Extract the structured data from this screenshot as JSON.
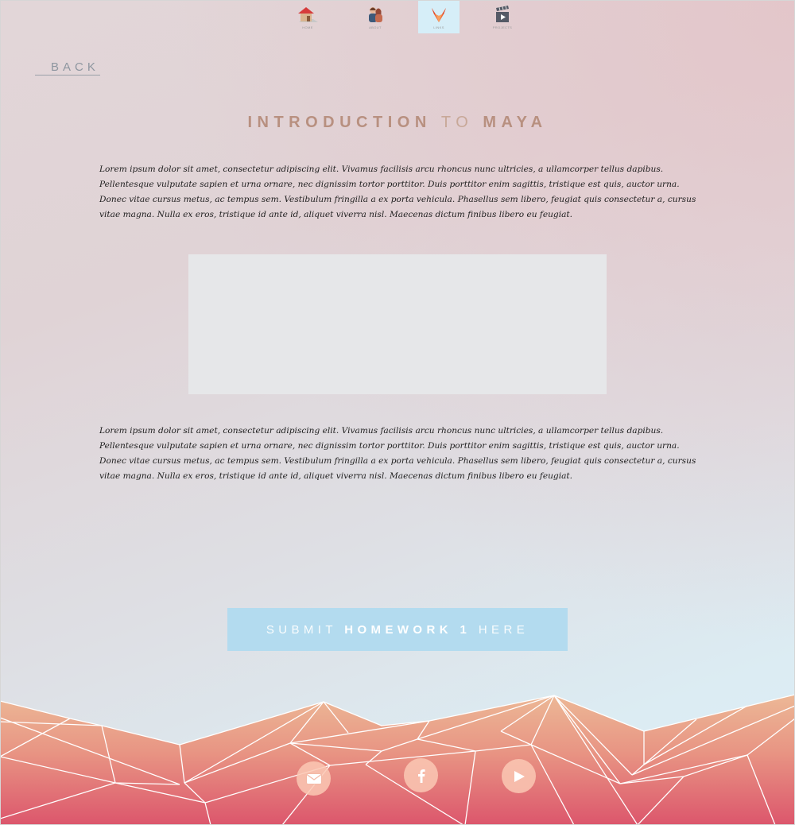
{
  "nav": {
    "items": [
      {
        "label": "HOME",
        "icon": "house-icon"
      },
      {
        "label": "ABOUT",
        "icon": "couple-icon"
      },
      {
        "label": "LINKS",
        "icon": "fox-icon"
      },
      {
        "label": "PROJECTS",
        "icon": "clapperboard-icon"
      }
    ],
    "active_index": 2
  },
  "back": {
    "label": "BACK"
  },
  "title": {
    "part1": "INTRODUCTION",
    "part2": "TO",
    "part3": "MAYA"
  },
  "paragraphs": [
    "Lorem ipsum dolor sit amet, consectetur adipiscing elit. Vivamus facilisis arcu rhoncus nunc ultricies, a ullamcorper tellus dapibus. Pellentesque vulputate sapien et urna ornare, nec dignissim tortor porttitor. Duis porttitor enim sagittis, tristique est quis, auctor urna. Donec vitae cursus metus, ac tempus sem. Vestibulum fringilla a ex porta vehicula. Phasellus sem libero, feugiat quis consectetur a, cursus vitae magna. Nulla ex eros, tristique id ante id, aliquet viverra nisl. Maecenas dictum finibus libero eu feugiat.",
    "Lorem ipsum dolor sit amet, consectetur adipiscing elit. Vivamus facilisis arcu rhoncus nunc ultricies, a ullamcorper tellus dapibus. Pellentesque vulputate sapien et urna ornare, nec dignissim tortor porttitor. Duis porttitor enim sagittis, tristique est quis, auctor urna. Donec vitae cursus metus, ac tempus sem. Vestibulum fringilla a ex porta vehicula. Phasellus sem libero, feugiat quis consectetur a, cursus vitae magna. Nulla ex eros, tristique id ante id, aliquet viverra nisl. Maecenas dictum finibus libero eu feugiat."
  ],
  "submit": {
    "part1": "SUBMIT",
    "part2": "HOMEWORK 1",
    "part3": "HERE"
  },
  "social": [
    {
      "icon": "mail-icon"
    },
    {
      "icon": "facebook-icon"
    },
    {
      "icon": "youtube-icon"
    }
  ],
  "colors": {
    "title": "#b89080",
    "button_bg": "#b3dbef",
    "nav_active_bg": "#d6eef8",
    "mountain_top": "#ebb394",
    "mountain_bottom": "#dd5a6e"
  }
}
